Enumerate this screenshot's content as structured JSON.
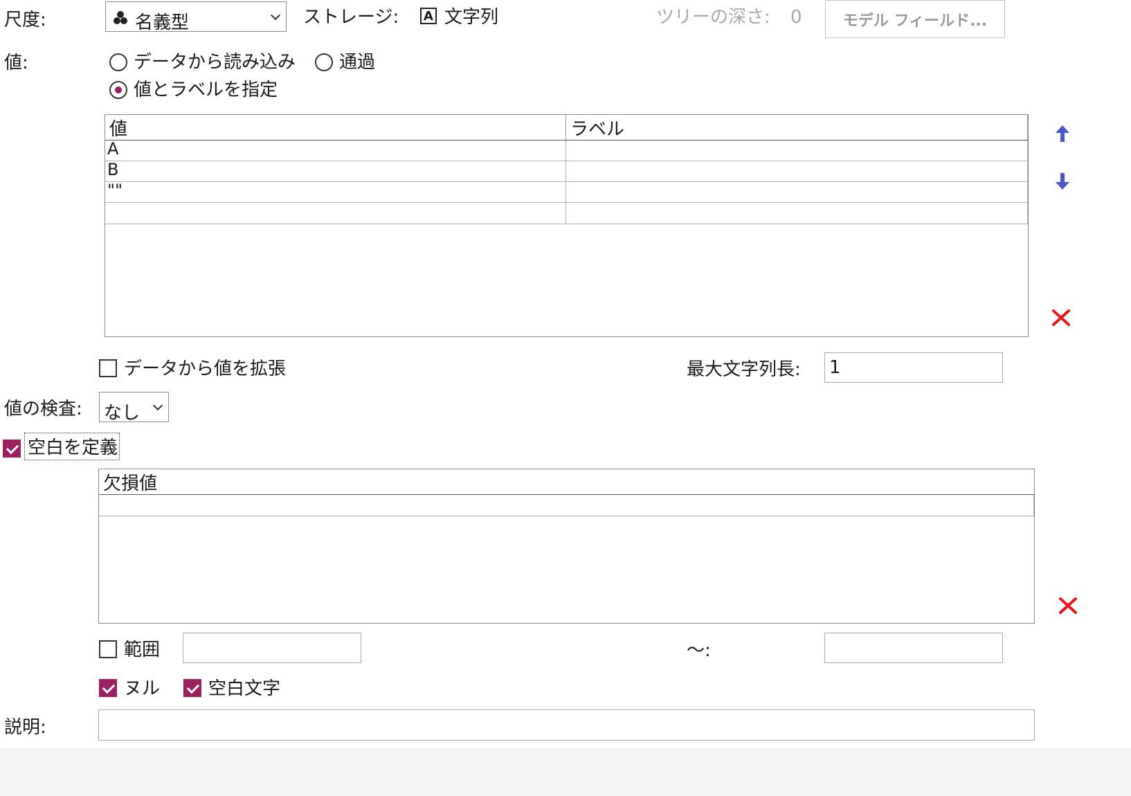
{
  "measurement": {
    "label": "尺度:",
    "value": "名義型",
    "icon": "nominal-three-circles-icon"
  },
  "storage": {
    "label": "ストレージ:",
    "icon": "text-A-icon",
    "icon_glyph": "A",
    "value": "文字列"
  },
  "tree_depth": {
    "label": "ツリーの深さ:",
    "value": "0"
  },
  "model_field_button": "モデル フィールド...",
  "values": {
    "label": "値:",
    "radio_read": "データから読み込み",
    "radio_pass": "通過",
    "radio_specify": "値とラベルを指定",
    "selected": "specify"
  },
  "value_table": {
    "headers": [
      "値",
      "ラベル"
    ],
    "rows": [
      {
        "value": "A",
        "label": ""
      },
      {
        "value": "B",
        "label": ""
      },
      {
        "value": "\"\"",
        "label": ""
      },
      {
        "value": "",
        "label": ""
      }
    ]
  },
  "side_icons": {
    "up": "arrow-up-icon",
    "down": "arrow-down-icon",
    "delete": "delete-x-icon",
    "up_glyph": "🡅",
    "down_glyph": "🡇",
    "delete_glyph": "✕"
  },
  "extend": {
    "label": "データから値を拡張",
    "checked": false
  },
  "max_length": {
    "label": "最大文字列長:",
    "value": "1"
  },
  "check": {
    "label": "値の検査:",
    "value": "なし"
  },
  "define_blank": {
    "label": "空白を定義",
    "checked": true
  },
  "missing_table": {
    "headers": [
      "欠損値"
    ],
    "rows": [
      {
        "value": ""
      }
    ]
  },
  "range": {
    "label": "範囲",
    "checked": false,
    "from": "",
    "to_label": "〜:",
    "to": ""
  },
  "null_cb": {
    "label": "ヌル",
    "checked": true
  },
  "whitespace_cb": {
    "label": "空白文字",
    "checked": true
  },
  "description": {
    "label": "説明:",
    "value": ""
  },
  "colors": {
    "accent": "#9b2060",
    "arrow": "#4a58c8",
    "delete": "#e8141c"
  }
}
